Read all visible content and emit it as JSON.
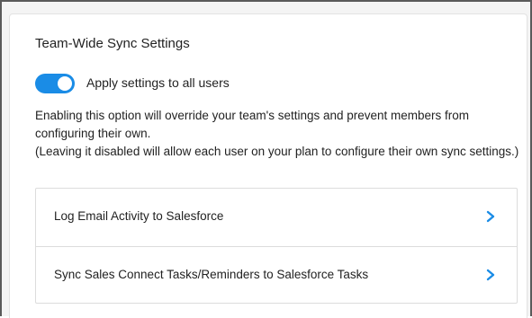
{
  "settings": {
    "title": "Team-Wide Sync Settings",
    "toggle": {
      "label": "Apply settings to all users",
      "enabled": true,
      "accent_color": "#1a8ce6"
    },
    "description": {
      "line1": "Enabling this option will override your team's settings and prevent members from",
      "line2": "configuring their own.",
      "line3": "(Leaving it disabled will allow each user on your plan to configure their own sync settings.)"
    },
    "items": [
      {
        "label": "Log Email Activity to Salesforce",
        "icon": "chevron-right-icon"
      },
      {
        "label": "Sync Sales Connect Tasks/Reminders to Salesforce Tasks",
        "icon": "chevron-right-icon"
      }
    ],
    "chevron_color": "#1a8ce6"
  }
}
